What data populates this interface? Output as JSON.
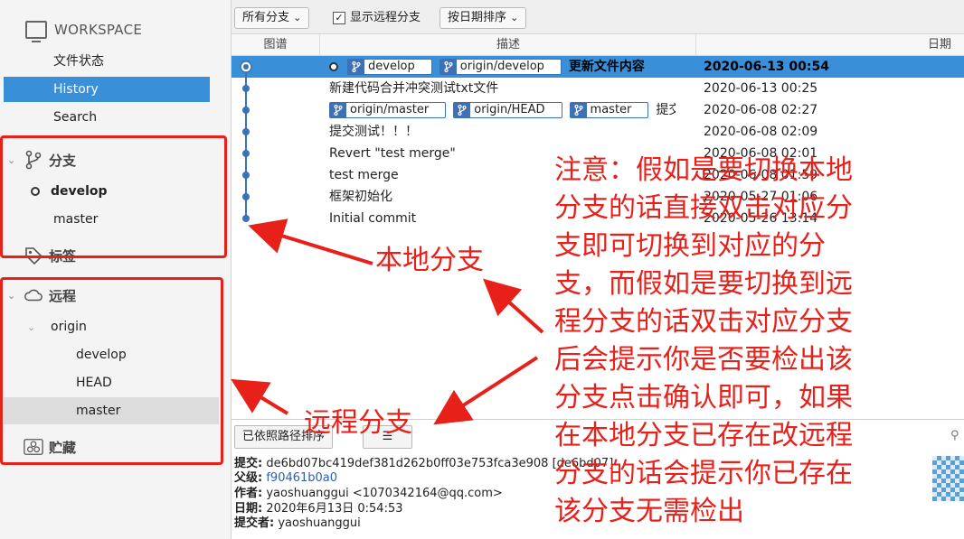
{
  "sidebar": {
    "workspace_title": "WORKSPACE",
    "workspace_items": [
      "文件状态",
      "History",
      "Search"
    ],
    "branches_title": "分支",
    "branches": [
      "develop",
      "master"
    ],
    "tags_title": "标签",
    "remotes_title": "远程",
    "remote_name": "origin",
    "remote_branches": [
      "develop",
      "HEAD",
      "master"
    ],
    "stash_title": "贮藏"
  },
  "toolbar": {
    "branch_filter": "所有分支",
    "show_remote_label": "显示远程分支",
    "show_remote_checked": true,
    "sort_label": "按日期排序"
  },
  "columns": {
    "graph": "图谱",
    "desc": "描述",
    "date": "日期"
  },
  "commits": [
    {
      "tags": [
        "develop",
        "origin/develop"
      ],
      "head": true,
      "subject": "更新文件内容",
      "date": "2020-06-13 00:54"
    },
    {
      "tags": [],
      "subject": "新建代码合并冲突测试txt文件",
      "date": "2020-06-13 00:25"
    },
    {
      "tags": [
        "origin/master",
        "origin/HEAD",
        "master"
      ],
      "subject": "提交",
      "date": "2020-06-08 02:27"
    },
    {
      "tags": [],
      "subject": "提交测试！！！",
      "date": "2020-06-08 02:09"
    },
    {
      "tags": [],
      "subject": "Revert \"test merge\"",
      "date": "2020-06-08 02:01"
    },
    {
      "tags": [],
      "subject": "test merge",
      "date": "2020-06-08 01:59"
    },
    {
      "tags": [],
      "subject": "框架初始化",
      "date": "2020-05-27 01:06"
    },
    {
      "tags": [],
      "subject": "Initial commit",
      "date": "2020-05-26 13:14"
    }
  ],
  "lower": {
    "sort_button": "已依照路径排序",
    "menu_button": "☰",
    "commit_label": "提交:",
    "commit_hash": "de6bd07bc419def381d262b0ff03e753fca3e908 [de6bd07]",
    "parent_label": "父级:",
    "parent_hash": "f90461b0a0",
    "author_label": "作者:",
    "author": "yaoshuanggui <1070342164@qq.com>",
    "date_label": "日期:",
    "date": "2020年6月13日 0:54:53",
    "committer_label": "提交者:",
    "committer": "yaoshuanggui"
  },
  "annotations": {
    "local_branch": "本地分支",
    "remote_branch": "远程分支",
    "note_lines": [
      "注意：假如是要切换本地",
      "分支的话直接双击对应分",
      "支即可切换到对应的分",
      "支，而假如是要切换到远",
      "程分支的话双击对应分支",
      "后会提示你是否要检出该",
      "分支点击确认即可，如果",
      "在本地分支已存在改远程",
      "分支的话会提示你已存在",
      "该分支无需检出"
    ]
  },
  "colors": {
    "accent": "#3a8fd9",
    "annotation": "#e8201a",
    "graph": "#3a72b8"
  }
}
